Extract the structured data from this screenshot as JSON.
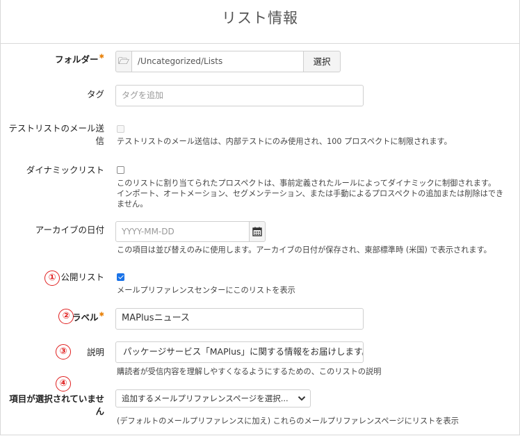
{
  "header": {
    "title": "リスト情報"
  },
  "fields": {
    "folder": {
      "label": "フォルダー",
      "value": "/Uncategorized/Lists",
      "button": "選択",
      "icon": "folder-icon"
    },
    "tags": {
      "label": "タグ",
      "placeholder": "タグを追加"
    },
    "test_email": {
      "label_line1": "テストリストのメール送",
      "label_line2": "信",
      "checked": false,
      "help": "テストリストのメール送信は、内部テストにのみ使用され、100 プロスペクトに制限されます。"
    },
    "dynamic": {
      "label": "ダイナミックリスト",
      "checked": false,
      "help_line1": "このリストに割り当てられたプロスペクトは、事前定義されたルールによってダイナミックに制御されます。",
      "help_line2": "インポート、オートメーション、セグメンテーション、または手動によるプロスペクトの追加または削除はでき",
      "help_line3": "ません。"
    },
    "archive": {
      "label": "アーカイブの日付",
      "placeholder": "YYYY-MM-DD",
      "icon": "calendar-icon",
      "help": "この項目は並び替えのみに使用します。アーカイブの日付が保存され、東部標準時 (米国) で表示されます。"
    },
    "public": {
      "marker": "①",
      "label": "公開リスト",
      "checked": true,
      "help": "メールプリファレンスセンターにこのリストを表示"
    },
    "label_field": {
      "marker": "②",
      "label": "ラベル",
      "value": "MAPlusニュース"
    },
    "description": {
      "marker": "③",
      "label": "説明",
      "value": "パッケージサービス「MAPlus」に関する情報をお届けします。",
      "help": "購読者が受信内容を理解しやすくなるようにするための、このリストの説明"
    },
    "pref_pages": {
      "marker": "④",
      "label_line1": "項目が選択されていませ",
      "label_line2": "ん",
      "select_text": "追加するメールプリファレンスページを選択...",
      "icon": "chevron-down-icon",
      "help": "(デフォルトのメールプリファレンスに加え) これらのメールプリファレンスページにリストを表示"
    }
  },
  "colors": {
    "required": "#e8820c",
    "marker": "#e01e1e",
    "checkbox": "#1a73e8"
  }
}
